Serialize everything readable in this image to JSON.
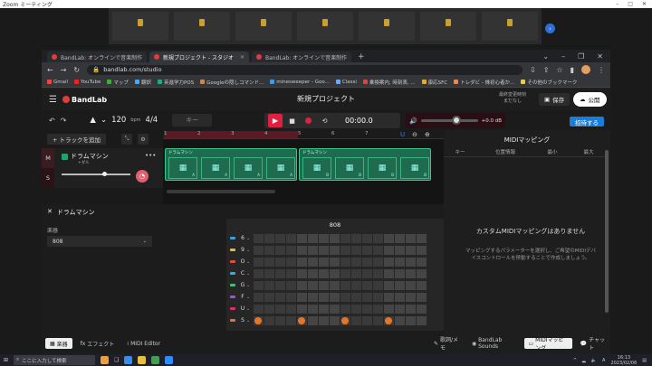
{
  "zoom": {
    "title": "Zoom ミーティング"
  },
  "browser": {
    "tabs": [
      {
        "label": "BandLab: オンラインで音楽制作",
        "active": false
      },
      {
        "label": "新規プロジェクト - スタジオ",
        "active": true
      },
      {
        "label": "BandLab: オンラインで音楽制作",
        "active": false
      }
    ],
    "url": "bandlab.com/studio",
    "bookmarks": [
      "Gmail",
      "YouTube",
      "マップ",
      "翻訳",
      "英進学力POS",
      "Googleの隠しコマンド...",
      "minesweeper - Goo...",
      "Classi",
      "乗換案内, 時刻表, ...",
      "康応SFC",
      "トレダビ - 株初心者か...",
      "その他のブックマーク"
    ]
  },
  "app": {
    "logo": "BandLab",
    "project_title": "新規プロジェクト",
    "sync_line1": "最終変更時刻",
    "sync_line2": "まだなし",
    "save_label": "保存",
    "publish_label": "公開",
    "invite_label": "招待する",
    "tempo": "120",
    "tempo_unit": "bpm",
    "time_sig": "4/4",
    "key": "キー",
    "timecode": "00:00.0",
    "volume_db": "+0.0 dB",
    "volume_level": 0.62
  },
  "track": {
    "add_label": "+ トラックを追加",
    "mute": "M",
    "solo": "S",
    "name": "ドラムマシン",
    "sub": "+ダル",
    "volume_level": 0.62
  },
  "arrange": {
    "ruler": [
      "1",
      "2",
      "3",
      "4",
      "5",
      "6",
      "7"
    ],
    "clips": [
      {
        "label": "ドラムマシン",
        "pads": [
          "A",
          "A",
          "A",
          "A"
        ]
      },
      {
        "label": "ドラムマシン",
        "pads": [
          "B",
          "B",
          "B",
          "B"
        ]
      }
    ]
  },
  "midi": {
    "title": "MIDIマッピング",
    "columns": [
      "キー",
      "位置情報",
      "最小",
      "最大"
    ],
    "empty_title": "カスタムMIDIマッピングはありません",
    "empty_desc": "マッピングするパラメーターを選択し、ご希望のMIDIデバイスコントロールを移動することで作成しましょう。"
  },
  "drum_panel": {
    "title": "ドラムマシン",
    "instrument_label": "楽器",
    "instrument_value": "808",
    "sequencer_title": "808",
    "rows": [
      {
        "label": "6",
        "color": "#3aa0e0",
        "steps": []
      },
      {
        "label": "9",
        "color": "#e0c030",
        "steps": []
      },
      {
        "label": "O",
        "color": "#e05030",
        "steps": []
      },
      {
        "label": "C",
        "color": "#30b0e0",
        "steps": []
      },
      {
        "label": "G",
        "color": "#40c070",
        "steps": []
      },
      {
        "label": "F",
        "color": "#a050e0",
        "steps": []
      },
      {
        "label": "U",
        "color": "#e03060",
        "steps": []
      },
      {
        "label": "S",
        "color": "#e8742a",
        "steps": [
          0,
          4,
          8,
          12
        ]
      }
    ],
    "step_count": 16
  },
  "bottom_tabs": [
    "楽器",
    "エフェクト",
    "MIDI Editor"
  ],
  "right_tabs": [
    "歌詞/メモ",
    "BandLab Sounds",
    "MIDIマッピング",
    "チャット"
  ],
  "taskbar": {
    "search_placeholder": "ここに入力して検索",
    "time": "16:13",
    "date": "2023/02/06",
    "lang": "A"
  },
  "colors": {
    "accent": "#e02040",
    "clip": "#1f6b50",
    "step_on": "#e8742a",
    "invite": "#1a7ed8"
  }
}
